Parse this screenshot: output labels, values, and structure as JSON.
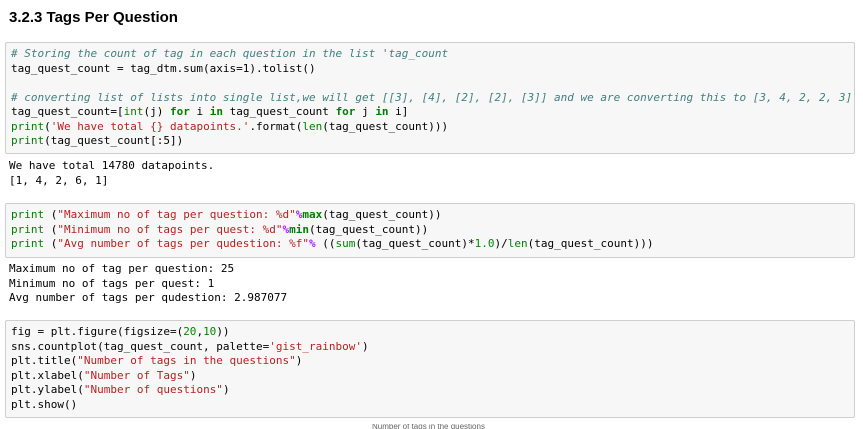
{
  "heading": "3.2.3 Tags Per Question",
  "cells": [
    {
      "lines": [
        [
          {
            "t": "com",
            "v": "# Storing the count of tag in each question in the list 'tag_count"
          }
        ],
        [
          {
            "t": "plain",
            "v": "tag_quest_count = tag_dtm.sum(axis=1).tolist()"
          }
        ],
        [
          {
            "t": "plain",
            "v": ""
          }
        ],
        [
          {
            "t": "com",
            "v": "# converting list of lists into single list,we will get [[3], [4], [2], [2], [3]] and we are converting this to [3, 4, 2, 2, 3]"
          }
        ],
        [
          {
            "t": "plain",
            "v": "tag_quest_count=["
          },
          {
            "t": "fn",
            "v": "int"
          },
          {
            "t": "plain",
            "v": "(j) "
          },
          {
            "t": "kw",
            "v": "for"
          },
          {
            "t": "plain",
            "v": " i "
          },
          {
            "t": "kw",
            "v": "in"
          },
          {
            "t": "plain",
            "v": " tag_quest_count "
          },
          {
            "t": "kw",
            "v": "for"
          },
          {
            "t": "plain",
            "v": " j "
          },
          {
            "t": "kw",
            "v": "in"
          },
          {
            "t": "plain",
            "v": " i]"
          }
        ],
        [
          {
            "t": "fn",
            "v": "print"
          },
          {
            "t": "plain",
            "v": "("
          },
          {
            "t": "str",
            "v": "'We have total {} datapoints.'"
          },
          {
            "t": "plain",
            "v": ".format("
          },
          {
            "t": "fn",
            "v": "len"
          },
          {
            "t": "plain",
            "v": "(tag_quest_count)))"
          }
        ],
        [
          {
            "t": "fn",
            "v": "print"
          },
          {
            "t": "plain",
            "v": "(tag_quest_count[:5])"
          }
        ]
      ],
      "output": [
        "We have total 14780 datapoints.",
        "[1, 4, 2, 6, 1]"
      ]
    },
    {
      "lines": [
        [
          {
            "t": "fn",
            "v": "print"
          },
          {
            "t": "plain",
            "v": " ("
          },
          {
            "t": "str",
            "v": "\"Maximum no of tag per question: %d\""
          },
          {
            "t": "op",
            "v": "%"
          },
          {
            "t": "kw",
            "v": "max"
          },
          {
            "t": "plain",
            "v": "(tag_quest_count))"
          }
        ],
        [
          {
            "t": "fn",
            "v": "print"
          },
          {
            "t": "plain",
            "v": " ("
          },
          {
            "t": "str",
            "v": "\"Minimum no of tags per quest: %d\""
          },
          {
            "t": "op",
            "v": "%"
          },
          {
            "t": "kw",
            "v": "min"
          },
          {
            "t": "plain",
            "v": "(tag_quest_count))"
          }
        ],
        [
          {
            "t": "fn",
            "v": "print"
          },
          {
            "t": "plain",
            "v": " ("
          },
          {
            "t": "str",
            "v": "\"Avg number of tags per qudestion: %f\""
          },
          {
            "t": "op",
            "v": "%"
          },
          {
            "t": "plain",
            "v": " (("
          },
          {
            "t": "fn",
            "v": "sum"
          },
          {
            "t": "plain",
            "v": "(tag_quest_count)*"
          },
          {
            "t": "num",
            "v": "1.0"
          },
          {
            "t": "plain",
            "v": ")/"
          },
          {
            "t": "fn",
            "v": "len"
          },
          {
            "t": "plain",
            "v": "(tag_quest_count)))"
          }
        ]
      ],
      "output": [
        "Maximum no of tag per question: 25",
        "Minimum no of tags per quest: 1",
        "Avg number of tags per qudestion: 2.987077"
      ]
    },
    {
      "lines": [
        [
          {
            "t": "plain",
            "v": "fig = plt.figure(figsize=("
          },
          {
            "t": "num",
            "v": "20"
          },
          {
            "t": "plain",
            "v": ","
          },
          {
            "t": "num",
            "v": "10"
          },
          {
            "t": "plain",
            "v": "))"
          }
        ],
        [
          {
            "t": "plain",
            "v": "sns.countplot(tag_quest_count, palette="
          },
          {
            "t": "str",
            "v": "'gist_rainbow'"
          },
          {
            "t": "plain",
            "v": ")"
          }
        ],
        [
          {
            "t": "plain",
            "v": "plt.title("
          },
          {
            "t": "str",
            "v": "\"Number of tags in the questions\""
          },
          {
            "t": "plain",
            "v": ")"
          }
        ],
        [
          {
            "t": "plain",
            "v": "plt.xlabel("
          },
          {
            "t": "str",
            "v": "\"Number of Tags\""
          },
          {
            "t": "plain",
            "v": ")"
          }
        ],
        [
          {
            "t": "plain",
            "v": "plt.ylabel("
          },
          {
            "t": "str",
            "v": "\"Number of questions\""
          },
          {
            "t": "plain",
            "v": ")"
          }
        ],
        [
          {
            "t": "plain",
            "v": "plt.show()"
          }
        ]
      ],
      "output": []
    }
  ],
  "chart_title_partial": "Number of tags in the questions",
  "colors": {
    "cell_bg": "#f7f7f7",
    "cell_border": "#cfcfcf",
    "comment": "#408080",
    "string": "#ba2121",
    "keyword": "#008000"
  }
}
